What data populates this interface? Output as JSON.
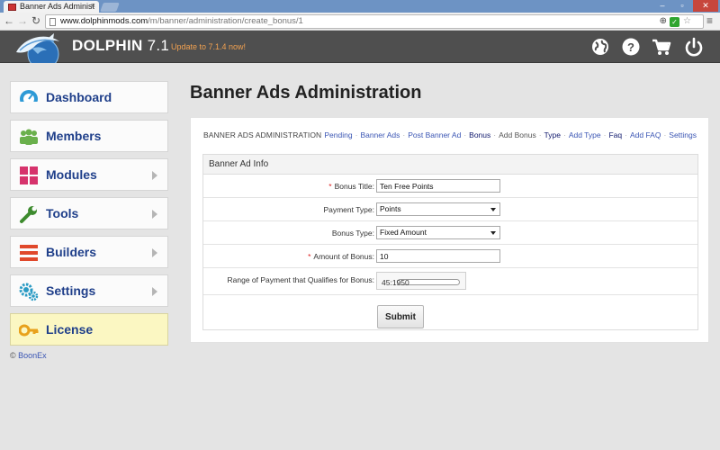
{
  "browser": {
    "tab_title": "Banner Ads Administ",
    "url_host": "www.dolphinmods.com",
    "url_path": "/m/banner/administration/create_bonus/1",
    "tab_close": "×"
  },
  "header": {
    "brand": "DOLPHIN",
    "version": "7.1",
    "update_link": "Update to 7.1.4 now!",
    "icons": [
      "globe-icon",
      "help-icon",
      "cart-icon",
      "power-icon"
    ]
  },
  "sidebar": {
    "items": [
      {
        "label": "Dashboard",
        "icon": "dashboard-icon",
        "arrow": false
      },
      {
        "label": "Members",
        "icon": "members-icon",
        "arrow": false
      },
      {
        "label": "Modules",
        "icon": "modules-icon",
        "arrow": true
      },
      {
        "label": "Tools",
        "icon": "wrench-icon",
        "arrow": true
      },
      {
        "label": "Builders",
        "icon": "builders-icon",
        "arrow": true
      },
      {
        "label": "Settings",
        "icon": "gears-icon",
        "arrow": true
      },
      {
        "label": "License",
        "icon": "key-icon",
        "arrow": false
      }
    ],
    "copyright_symbol": "©",
    "copyright_link": "BoonEx"
  },
  "main": {
    "title": "Banner Ads Administration",
    "panel_caption": "BANNER ADS ADMINISTRATION",
    "submenu": [
      {
        "label": "Pending",
        "style": "link"
      },
      {
        "label": "Banner Ads",
        "style": "link"
      },
      {
        "label": "Post Banner Ad",
        "style": "link"
      },
      {
        "label": "Bonus",
        "style": "bold"
      },
      {
        "label": "Add Bonus",
        "style": "plain"
      },
      {
        "label": "Type",
        "style": "bold"
      },
      {
        "label": "Add Type",
        "style": "link"
      },
      {
        "label": "Faq",
        "style": "bold"
      },
      {
        "label": "Add FAQ",
        "style": "link"
      },
      {
        "label": "Settings",
        "style": "link"
      }
    ],
    "form": {
      "section_title": "Banner Ad Info",
      "bonus_title": {
        "label": "Bonus Title:",
        "required": "*",
        "value": "Ten Free Points"
      },
      "payment_type": {
        "label": "Payment Type:",
        "value": "Points"
      },
      "bonus_type": {
        "label": "Bonus Type:",
        "value": "Fixed Amount"
      },
      "amount": {
        "label": "Amount of Bonus:",
        "required": "*",
        "value": "10"
      },
      "range": {
        "label": "Range of Payment that Qualifies for Bonus:",
        "value": "45:1950"
      },
      "submit_label": "Submit"
    }
  }
}
